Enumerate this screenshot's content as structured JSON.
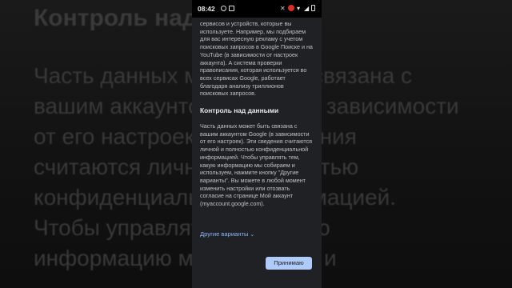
{
  "background": {
    "heading": "Контроль над данными",
    "lines": [
      "Часть данных может быть связана с",
      "вашим аккаунтом Google (в зависимости",
      "от его настроек). Эти сведения",
      "считаются личной и полностью",
      "конфиденциальной информацией.",
      "Чтобы управлять тем, какую",
      "информацию мы собираем и"
    ]
  },
  "statusbar": {
    "time": "08:42"
  },
  "dialog": {
    "intro_text": "сервисов и устройств, которые вы используете. Например, мы подбираем для вас интересную рекламу с учетом поисковых запросов в Google Поиске и на YouTube (в зависимости от настроек аккаунта). А система проверки правописания, которая используется во всех сервисах Google, работает благодаря анализу триллионов поисковых запросов.",
    "section_title": "Контроль над данными",
    "section_text": "Часть данных может быть связана с вашим аккаунтом Google (в зависимости от его настроек). Эти сведения считаются личной и полностью конфиденциальной информацией. Чтобы управлять тем, какую информацию мы собираем и используем, нажмите кнопку \"Другие варианты\". Вы можете в любой момент изменить настройки или отозвать согласие на странице Мой аккаунт (myaccount.google.com).",
    "more_options": "Другие варианты",
    "accept_button": "Принимаю"
  },
  "colors": {
    "dialog_bg": "#202124",
    "link": "#8ab4f8",
    "button_bg": "#aecbfa"
  }
}
